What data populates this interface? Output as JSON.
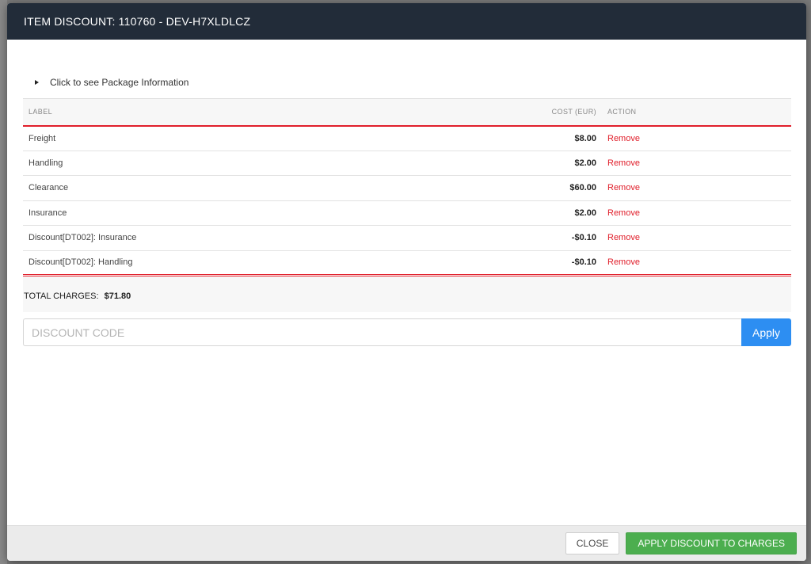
{
  "modal": {
    "title": "ITEM DISCOUNT: 110760 - DEV-H7XLDLCZ"
  },
  "package_toggle": {
    "label": "Click to see Package Information",
    "icon": "caret-right-icon"
  },
  "charges_table": {
    "headers": {
      "label": "LABEL",
      "cost": "COST (EUR)",
      "action": "ACTION"
    },
    "rows": [
      {
        "label": "Freight",
        "cost": "$8.00",
        "action": "Remove"
      },
      {
        "label": "Handling",
        "cost": "$2.00",
        "action": "Remove"
      },
      {
        "label": "Clearance",
        "cost": "$60.00",
        "action": "Remove"
      },
      {
        "label": "Insurance",
        "cost": "$2.00",
        "action": "Remove"
      },
      {
        "label": "Discount[DT002]: Insurance",
        "cost": "-$0.10",
        "action": "Remove"
      },
      {
        "label": "Discount[DT002]: Handling",
        "cost": "-$0.10",
        "action": "Remove"
      }
    ],
    "total_label": "TOTAL CHARGES:",
    "total_value": "$71.80"
  },
  "discount": {
    "placeholder": "DISCOUNT CODE",
    "value": "",
    "apply_label": "Apply"
  },
  "footer": {
    "close_label": "CLOSE",
    "apply_label": "APPLY DISCOUNT TO CHARGES"
  },
  "colors": {
    "header_bg": "#222c39",
    "accent_red": "#e01e2a",
    "apply_blue": "#2d8ef2",
    "apply_green": "#4cae4f"
  }
}
